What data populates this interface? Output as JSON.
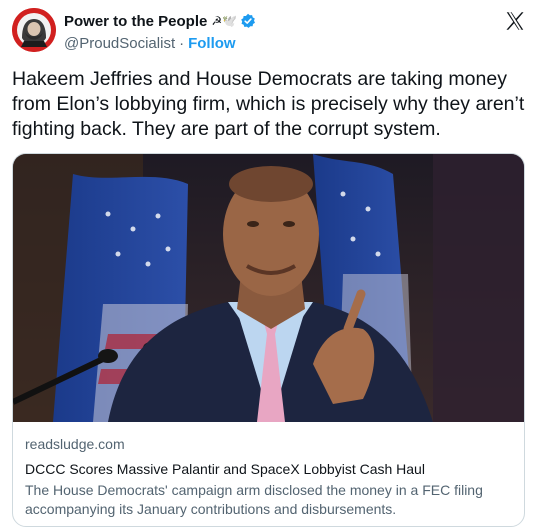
{
  "author": {
    "display_name": "Power to the People",
    "emoji": "☭🕊️",
    "handle": "@ProudSocialist",
    "separator": "·",
    "follow_label": "Follow"
  },
  "tweet": {
    "text": "Hakeem Jeffries and House Democrats are taking money from Elon’s lobbying firm, which is precisely why they aren’t fighting back. They are part of the corrupt system."
  },
  "card": {
    "domain": "readsludge.com",
    "title": "DCCC Scores Massive Palantir and SpaceX Lobbyist Cash Haul",
    "description": "The House Democrats' campaign arm disclosed the money in a FEC filing accompanying its January contributions and disbursements."
  },
  "icons": {
    "verified": "verified-badge-icon",
    "platform": "x-logo-icon"
  },
  "colors": {
    "link_blue": "#1d9bf0",
    "avatar_red": "#d1201f",
    "secondary_text": "#536471"
  }
}
